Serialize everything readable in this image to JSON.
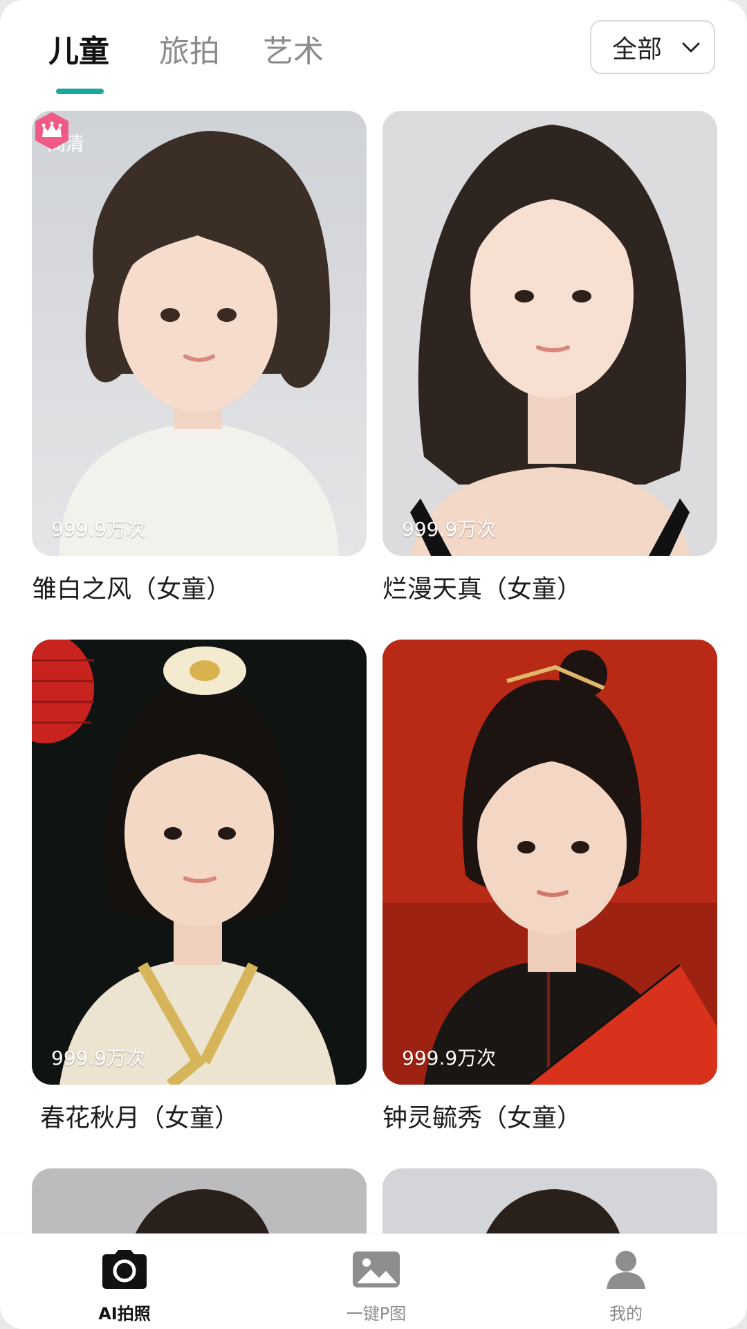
{
  "tabs": [
    {
      "label": "儿童",
      "active": true
    },
    {
      "label": "旅拍",
      "active": false
    },
    {
      "label": "艺术",
      "active": false
    }
  ],
  "accent_color": "#1aa89b",
  "filter": {
    "label": "全部",
    "icon": "chevron-down-icon"
  },
  "cards": [
    {
      "title": "雏白之风（女童）",
      "count": "999.9万次",
      "badge_text": "高清",
      "vip_icon": "crown-icon"
    },
    {
      "title": "烂漫天真（女童）",
      "count": "999.9万次"
    },
    {
      "title": "春花秋月（女童）",
      "count": "999.9万次"
    },
    {
      "title": "钟灵毓秀（女童）",
      "count": "999.9万次"
    }
  ],
  "bottom_nav": [
    {
      "label": "AI拍照",
      "icon": "camera-icon",
      "active": true
    },
    {
      "label": "一键P图",
      "icon": "image-icon",
      "active": false
    },
    {
      "label": "我的",
      "icon": "profile-icon",
      "active": false
    }
  ]
}
